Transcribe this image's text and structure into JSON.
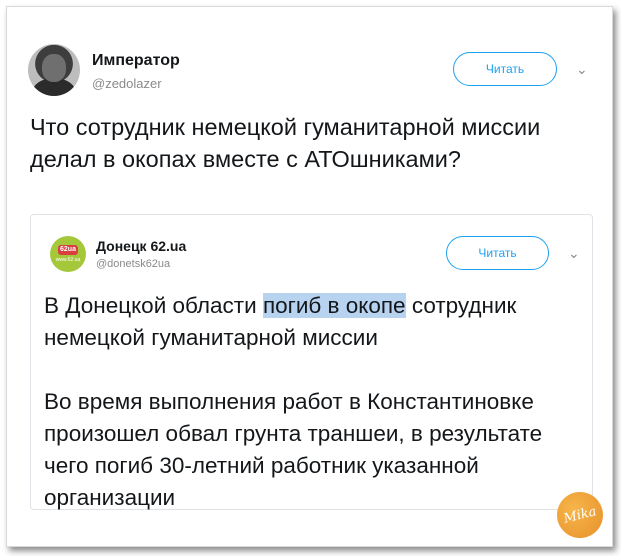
{
  "tweet": {
    "author_name": "Император",
    "author_handle": "@zedolazer",
    "follow_label": "Читать",
    "menu_icon": "chevron-down-icon",
    "text": "Что сотрудник немецкой гуманитарной миссии делал в окопах вместе с АТОшниками?"
  },
  "quoted_tweet": {
    "author_name": "Донецк 62.ua",
    "author_handle": "@donetsk62ua",
    "avatar_logo": "62ua",
    "avatar_sub": "www.62.ua",
    "follow_label": "Читать",
    "menu_icon": "chevron-down-icon",
    "p1_before": "В Донецкой области ",
    "p1_highlight": "погиб в окопе",
    "p1_after": " сотрудник немецкой гуманитарной миссии",
    "p2": "Во время выполнения работ в Константиновке произошел обвал грунта траншеи, в результате чего погиб 30-летний работник указанной организации"
  },
  "watermark": {
    "text": "Mika"
  },
  "colors": {
    "accent": "#1da1f2",
    "highlight": "#b7d3ef",
    "muted": "#8a8a8a"
  }
}
